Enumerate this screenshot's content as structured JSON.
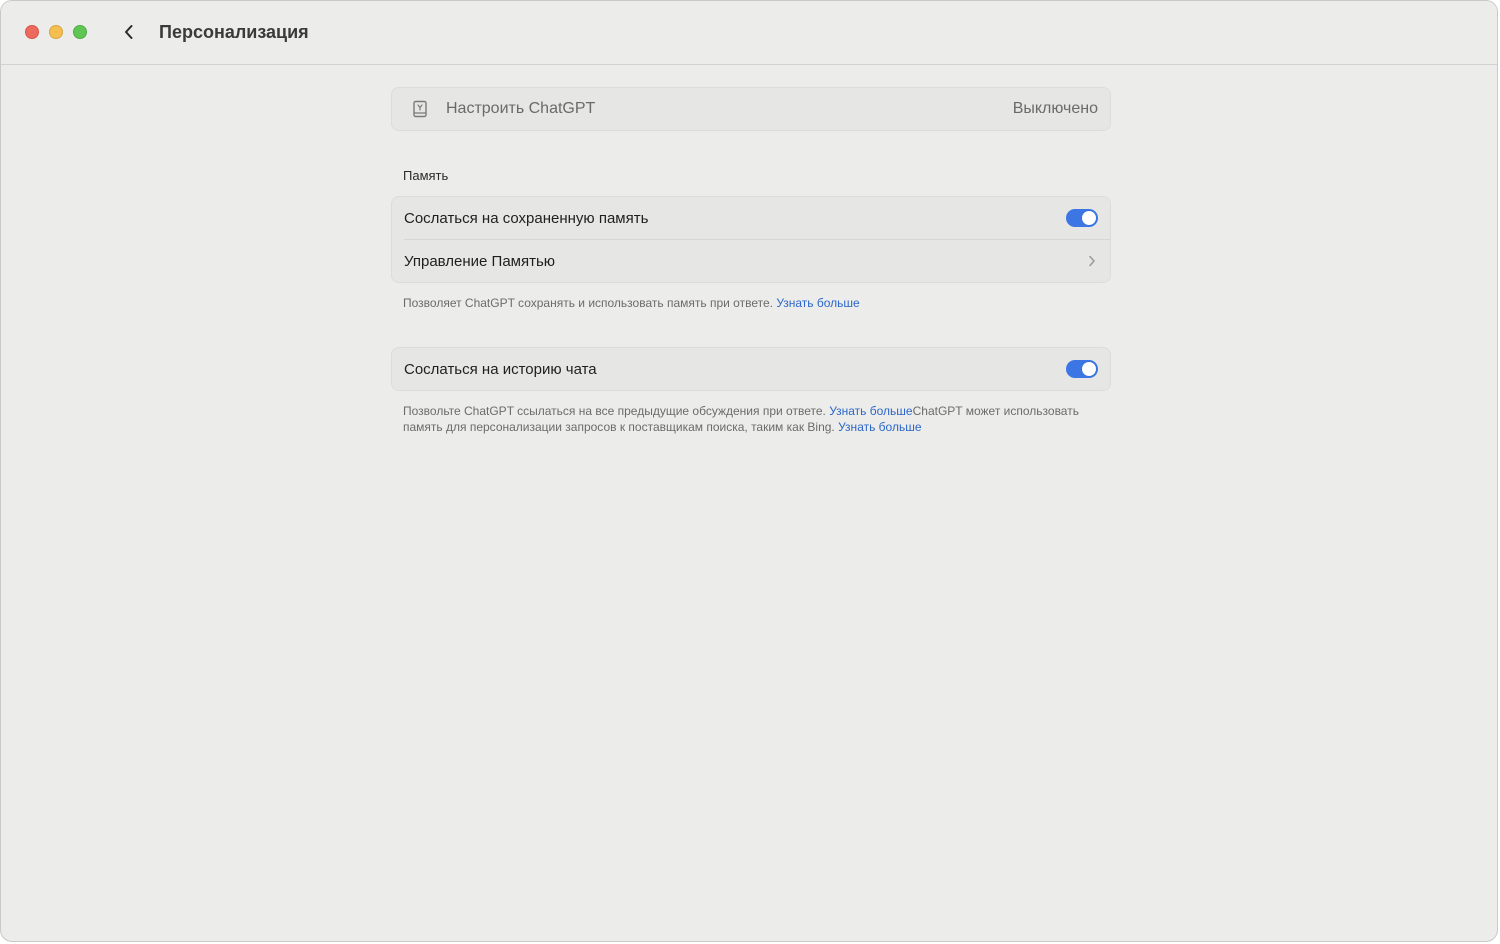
{
  "header": {
    "title": "Персонализация"
  },
  "customize": {
    "label": "Настроить ChatGPT",
    "value": "Выключено",
    "icon": "customize-icon"
  },
  "memory_section": {
    "header": "Память",
    "reference_memory": {
      "label": "Сослаться на сохраненную память",
      "enabled": true
    },
    "manage_memory": {
      "label": "Управление Памятью"
    },
    "footnote": "Позволяет ChatGPT сохранять и использовать память при ответе.",
    "footnote_link": "Узнать больше"
  },
  "history_section": {
    "reference_history": {
      "label": "Сослаться на историю чата",
      "enabled": true
    },
    "footnote_part1": "Позвольте ChatGPT ссылаться на все предыдущие обсуждения при ответе. ",
    "footnote_link1": "Узнать больше",
    "footnote_part2": "ChatGPT может использовать память для персонализации запросов к поставщикам поиска, таким как Bing. ",
    "footnote_link2": "Узнать больше"
  },
  "colors": {
    "accent": "#3b76e4",
    "link": "#2c67c9",
    "window_bg": "#ececeb"
  }
}
